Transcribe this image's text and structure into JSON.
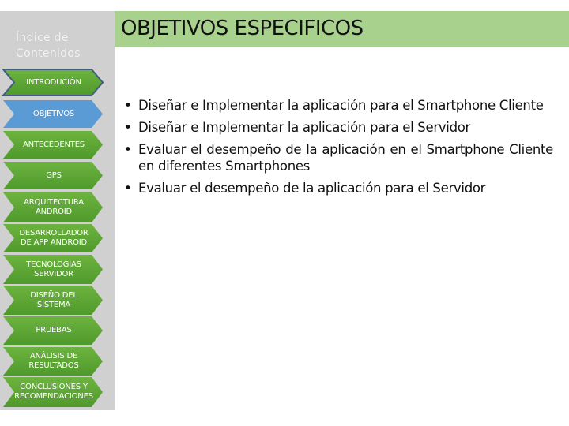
{
  "sidebar": {
    "title": "Índice de Contenidos",
    "items": [
      {
        "label": "INTRODUCIÓN",
        "state": "visited"
      },
      {
        "label": "OBJETIVOS",
        "state": "active"
      },
      {
        "label": "ANTECEDENTES",
        "state": "normal"
      },
      {
        "label": "GPS",
        "state": "normal"
      },
      {
        "label": "ARQUITECTURA ANDROID",
        "state": "normal"
      },
      {
        "label": "DESARROLLADOR DE APP ANDROID",
        "state": "normal"
      },
      {
        "label": "TECNOLOGIAS SERVIDOR",
        "state": "normal"
      },
      {
        "label": "DISEÑO DEL SISTEMA",
        "state": "normal"
      },
      {
        "label": "PRUEBAS",
        "state": "normal"
      },
      {
        "label": "ANÁLISIS DE RESULTADOS",
        "state": "normal"
      },
      {
        "label": "CONCLUSIONES Y RECOMENDACIONES",
        "state": "normal"
      }
    ]
  },
  "header": {
    "title": "OBJETIVOS ESPECIFICOS"
  },
  "main": {
    "bullets": [
      "Diseñar e Implementar la aplicación para el Smartphone Cliente",
      "Diseñar e Implementar la aplicación para el Servidor",
      "Evaluar el desempeño de la aplicación en el Smartphone Cliente en diferentes Smartphones",
      "Evaluar el desempeño de la aplicación para el Servidor"
    ]
  },
  "colors": {
    "sidebar_bg": "#d0d0d0",
    "title_bar": "#a9d18e",
    "chevron_green": "#6db33f",
    "chevron_green_dark": "#4f9a2c",
    "chevron_active": "#5b9bd5",
    "chevron_visited_border": "#41607f"
  }
}
